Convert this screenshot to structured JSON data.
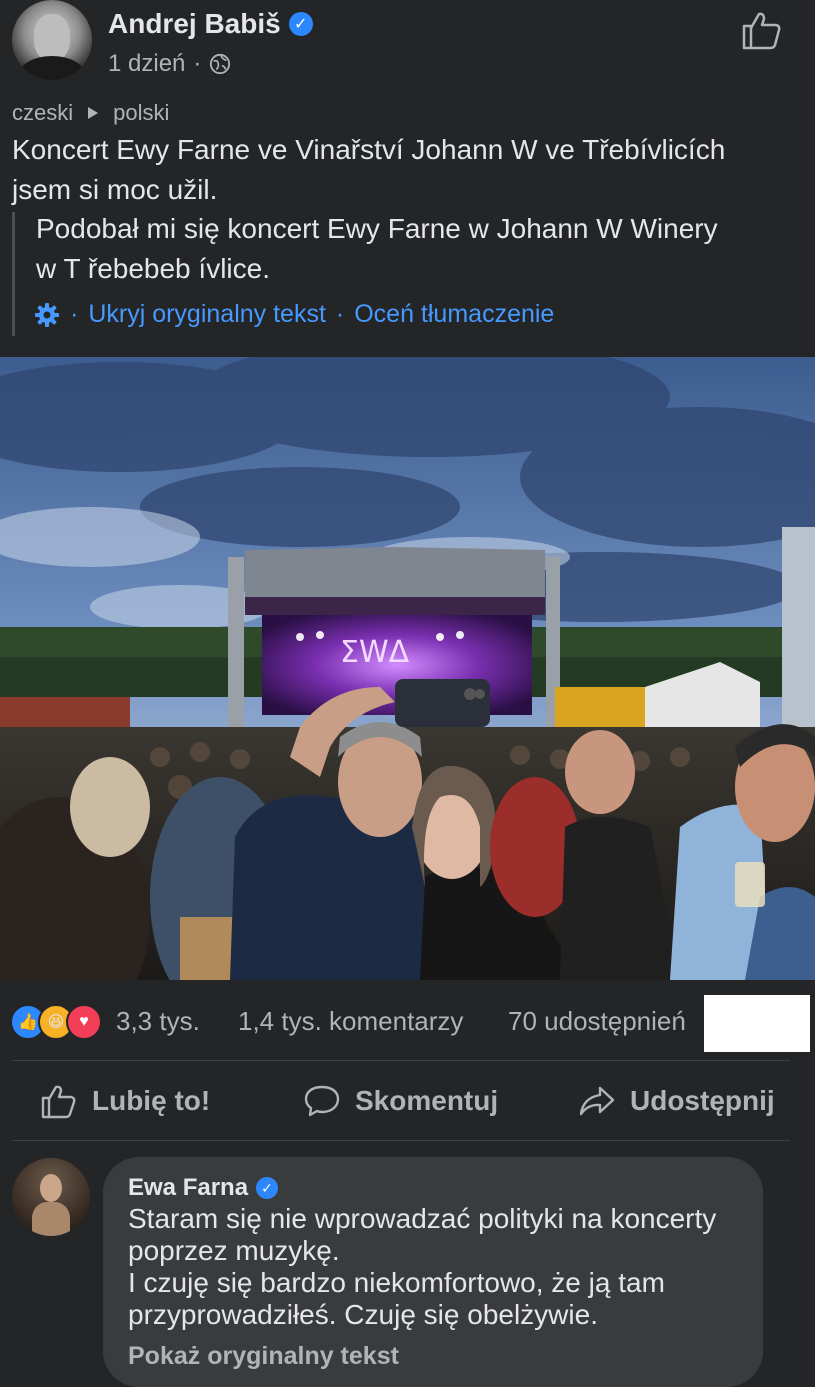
{
  "post": {
    "author": "Andrej Babiš",
    "time": "1 dzień",
    "meta_sep": "·",
    "translation": {
      "from_lang": "czeski",
      "to_lang": "polski",
      "original_line1": "Koncert Ewy Farne ve Vinařství Johann W ve Třebívlicích",
      "original_line2": "jsem si moc užil.",
      "translated_line1": "Podobał mi się koncert Ewy Farne w Johann W Winery",
      "translated_line2": "w T řebebeb ívlice.",
      "hide_original": "Ukryj oryginalny tekst",
      "rate_translation": "Oceń tłumaczenie",
      "link_sep": "·"
    },
    "stage_sign": "ΣWΔ"
  },
  "stats": {
    "reactions_count": "3,3 tys.",
    "comments": "1,4 tys. komentarzy",
    "shares": "70 udostępnień"
  },
  "actions": {
    "like": "Lubię to!",
    "comment": "Skomentuj",
    "share": "Udostępnij"
  },
  "comment": {
    "author": "Ewa Farna",
    "line1": "Staram się nie wprowadzać polityki na koncerty",
    "line2": "poprzez muzykę.",
    "line3": "I czuję się bardzo niekomfortowo, że ją tam",
    "line4": "przyprowadziłeś. Czuję się obelżywie.",
    "show_original": "Pokaż oryginalny tekst"
  },
  "icons": {
    "verified": "verified-badge-icon",
    "globe": "globe-icon",
    "like": "thumbs-up-icon",
    "comment": "speech-bubble-icon",
    "share": "share-arrow-icon",
    "gear": "gear-icon"
  },
  "colors": {
    "background": "#242526",
    "link": "#4599ff",
    "verified": "#2d88ff",
    "bubble": "#3a3b3c"
  }
}
